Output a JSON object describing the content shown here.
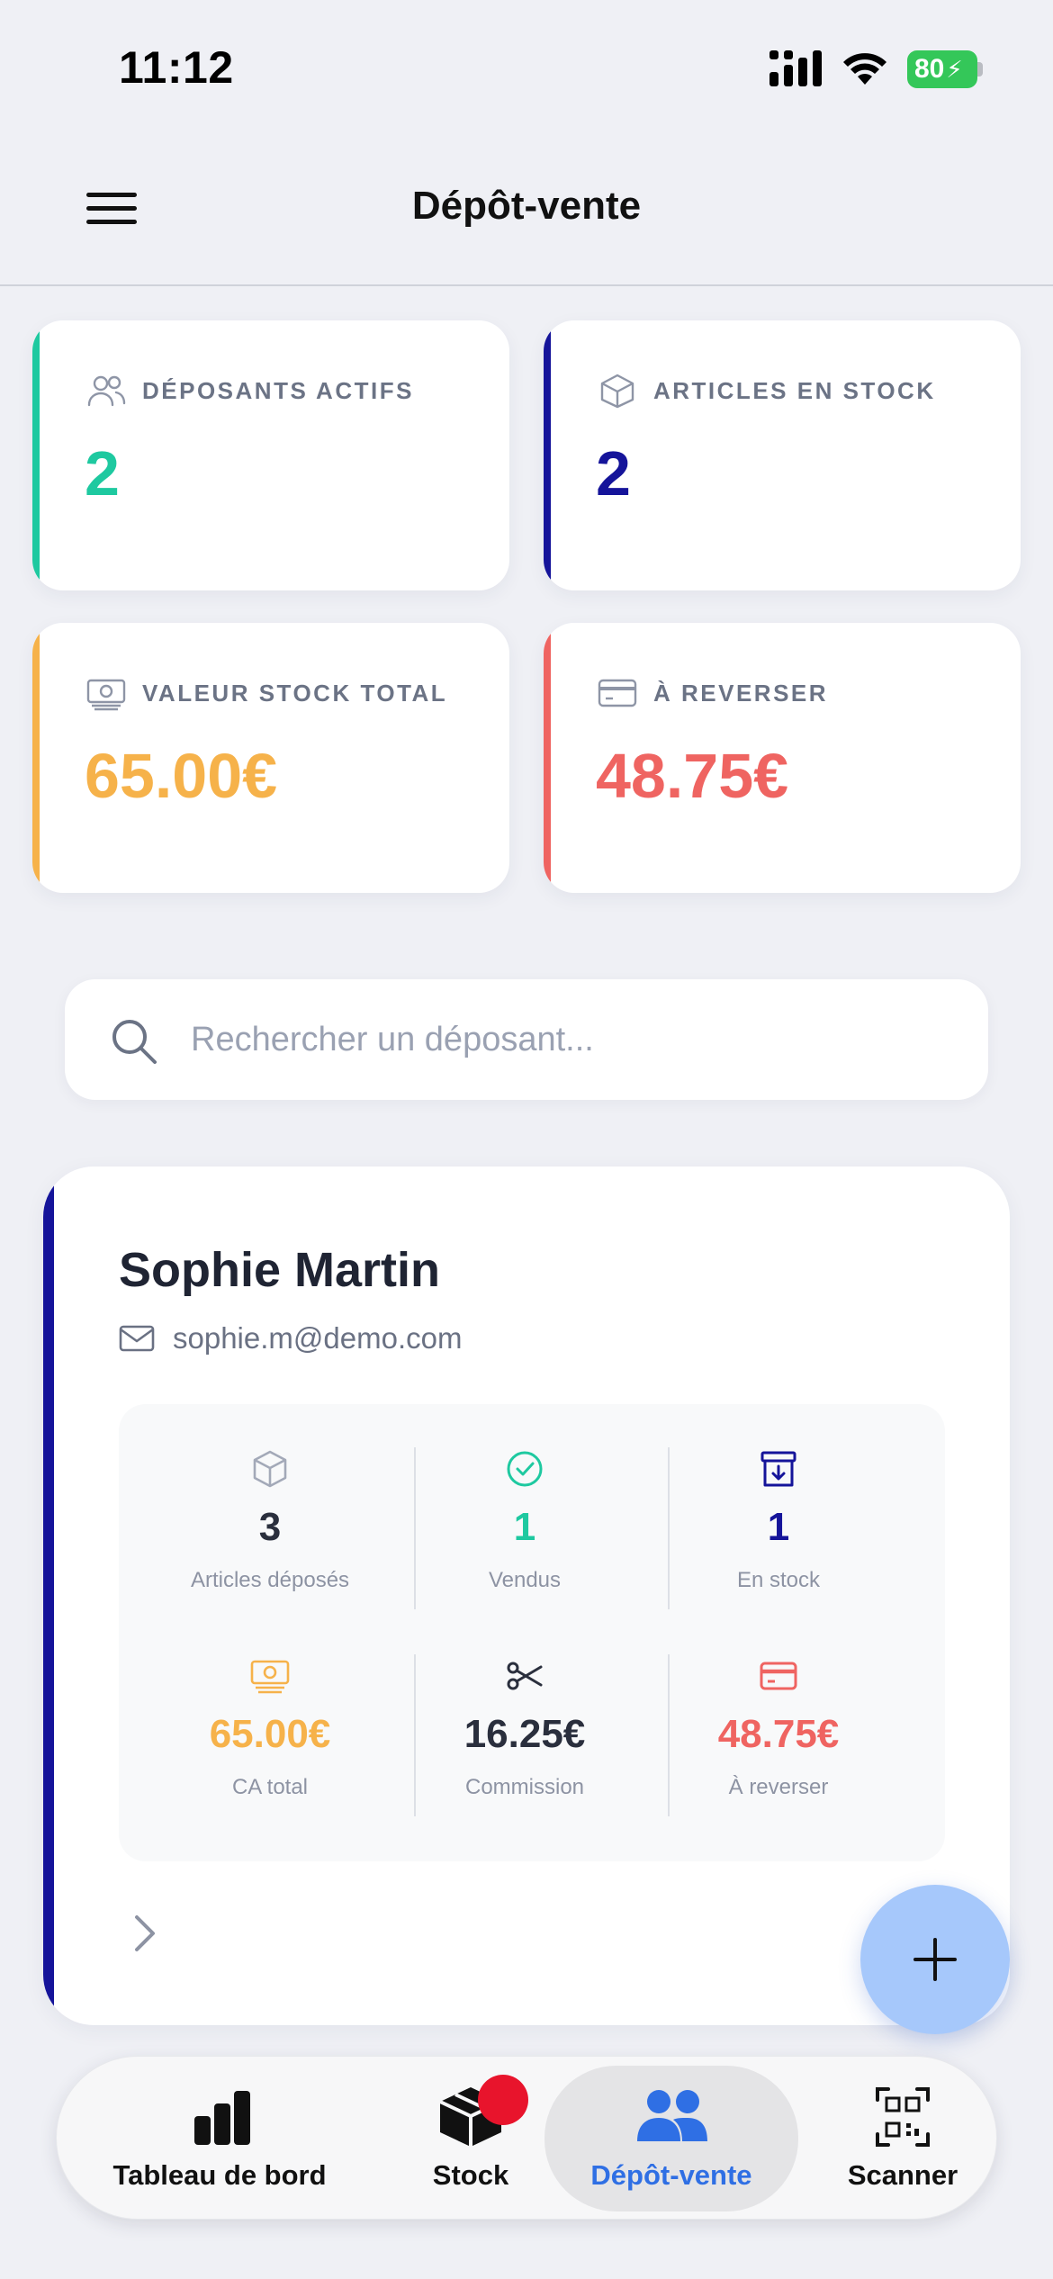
{
  "status_bar": {
    "time": "11:12",
    "battery": "80"
  },
  "header": {
    "title": "Dépôt-vente"
  },
  "stats": [
    {
      "label": "DÉPOSANTS ACTIFS",
      "value": "2",
      "icon": "users-icon",
      "color": "#1ec9a0"
    },
    {
      "label": "ARTICLES EN STOCK",
      "value": "2",
      "icon": "box-icon",
      "color": "#15149a"
    },
    {
      "label": "VALEUR STOCK TOTAL",
      "value": "65.00€",
      "icon": "banknote-icon",
      "color": "#f6b24a"
    },
    {
      "label": "À REVERSER",
      "value": "48.75€",
      "icon": "credit-card-icon",
      "color": "#ef6461"
    }
  ],
  "search": {
    "placeholder": "Rechercher un déposant..."
  },
  "depositor": {
    "name": "Sophie Martin",
    "email": "sophie.m@demo.com",
    "stats": [
      {
        "value": "3",
        "label": "Articles déposés",
        "icon": "box-icon"
      },
      {
        "value": "1",
        "label": "Vendus",
        "icon": "check-circle-icon"
      },
      {
        "value": "1",
        "label": "En stock",
        "icon": "archive-icon"
      },
      {
        "value": "65.00€",
        "label": "CA total",
        "icon": "banknote-icon"
      },
      {
        "value": "16.25€",
        "label": "Commission",
        "icon": "scissors-icon"
      },
      {
        "value": "48.75€",
        "label": "À reverser",
        "icon": "credit-card-icon"
      }
    ]
  },
  "tabs": [
    {
      "label": "Tableau de bord",
      "icon": "bar-chart-icon"
    },
    {
      "label": "Stock",
      "icon": "box-icon"
    },
    {
      "label": "Dépôt-vente",
      "icon": "users-icon",
      "active": true
    },
    {
      "label": "Scanner",
      "icon": "qr-code-icon"
    }
  ],
  "colors": {
    "accent": "#2f6fe4",
    "teal": "#1ec9a0",
    "navy": "#15149a",
    "orange": "#f6b24a",
    "red": "#ef6461",
    "fab": "#a6c8fb"
  }
}
